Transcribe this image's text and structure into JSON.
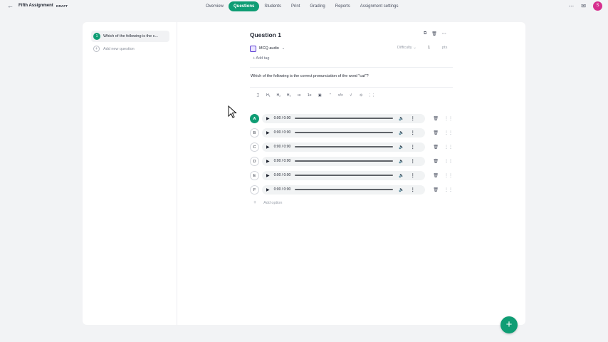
{
  "header": {
    "back_icon": "arrow-left-icon",
    "assignment_title": "Fifth Assignment",
    "status": "DRAFT",
    "tabs": [
      {
        "label": "Overview",
        "active": false
      },
      {
        "label": "Questions",
        "active": true
      },
      {
        "label": "Students",
        "active": false
      },
      {
        "label": "Print",
        "active": false
      },
      {
        "label": "Grading",
        "active": false
      },
      {
        "label": "Reports",
        "active": false
      },
      {
        "label": "Assignment settings",
        "active": false
      }
    ],
    "more_icon": "ellipsis-icon",
    "calendar_icon": "calendar-icon",
    "avatar_initial": "S",
    "avatar_color": "#d62f8e"
  },
  "sidebar": {
    "items": [
      {
        "number": "1",
        "label": "Which of the following is the c..."
      }
    ],
    "add_label": "Add new question"
  },
  "question": {
    "title": "Question 1",
    "actions": [
      "copy-icon",
      "trash-icon",
      "ellipsis-icon"
    ],
    "type_label": "MCQ audio",
    "difficulty_label": "Difficulty",
    "points_value": "1",
    "points_label": "pts",
    "add_tag_label": "+ Add tag",
    "prompt": "Which of the following is the correct pronunciation of the word \"cat\"?",
    "toolbar": [
      "T̲",
      "H₁",
      "H₂",
      "H₃",
      "•≡",
      "1≡",
      "▣",
      "”",
      "</>",
      "√",
      "⊙",
      "⋮⋮"
    ],
    "options": [
      {
        "letter": "A",
        "time": "0:00 / 0:00",
        "selected": true
      },
      {
        "letter": "B",
        "time": "0:00 / 0:00",
        "selected": false
      },
      {
        "letter": "C",
        "time": "0:00 / 0:00",
        "selected": false
      },
      {
        "letter": "D",
        "time": "0:00 / 0:00",
        "selected": false
      },
      {
        "letter": "E",
        "time": "0:00 / 0:00",
        "selected": false
      },
      {
        "letter": "F",
        "time": "0:00 / 0:00",
        "selected": false
      }
    ],
    "add_option_label": "Add option"
  },
  "fab_icon": "plus-icon",
  "accent_color": "#0f9d74"
}
